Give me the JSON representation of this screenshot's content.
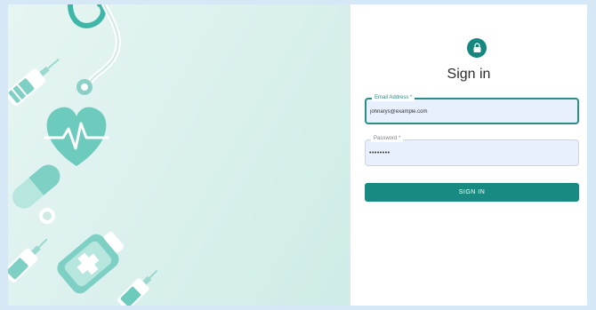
{
  "colors": {
    "accent": "#198a82",
    "field_background": "#e8f0fe",
    "hero_background": "#dcf1ee",
    "medical_icon": "#7fd0c4"
  },
  "hero": {
    "icons": [
      "stethoscope-icon",
      "syringe-icon",
      "heart-pulse-icon",
      "capsule-icon",
      "medicine-bottle-icon"
    ]
  },
  "signin_form": {
    "lock_icon": "lock-icon",
    "title": "Sign in",
    "email_label": "Email Address *",
    "email_value": "johnarys@example.com",
    "password_label": "Password *",
    "password_value": "••••••••",
    "submit_label": "SIGN IN"
  }
}
